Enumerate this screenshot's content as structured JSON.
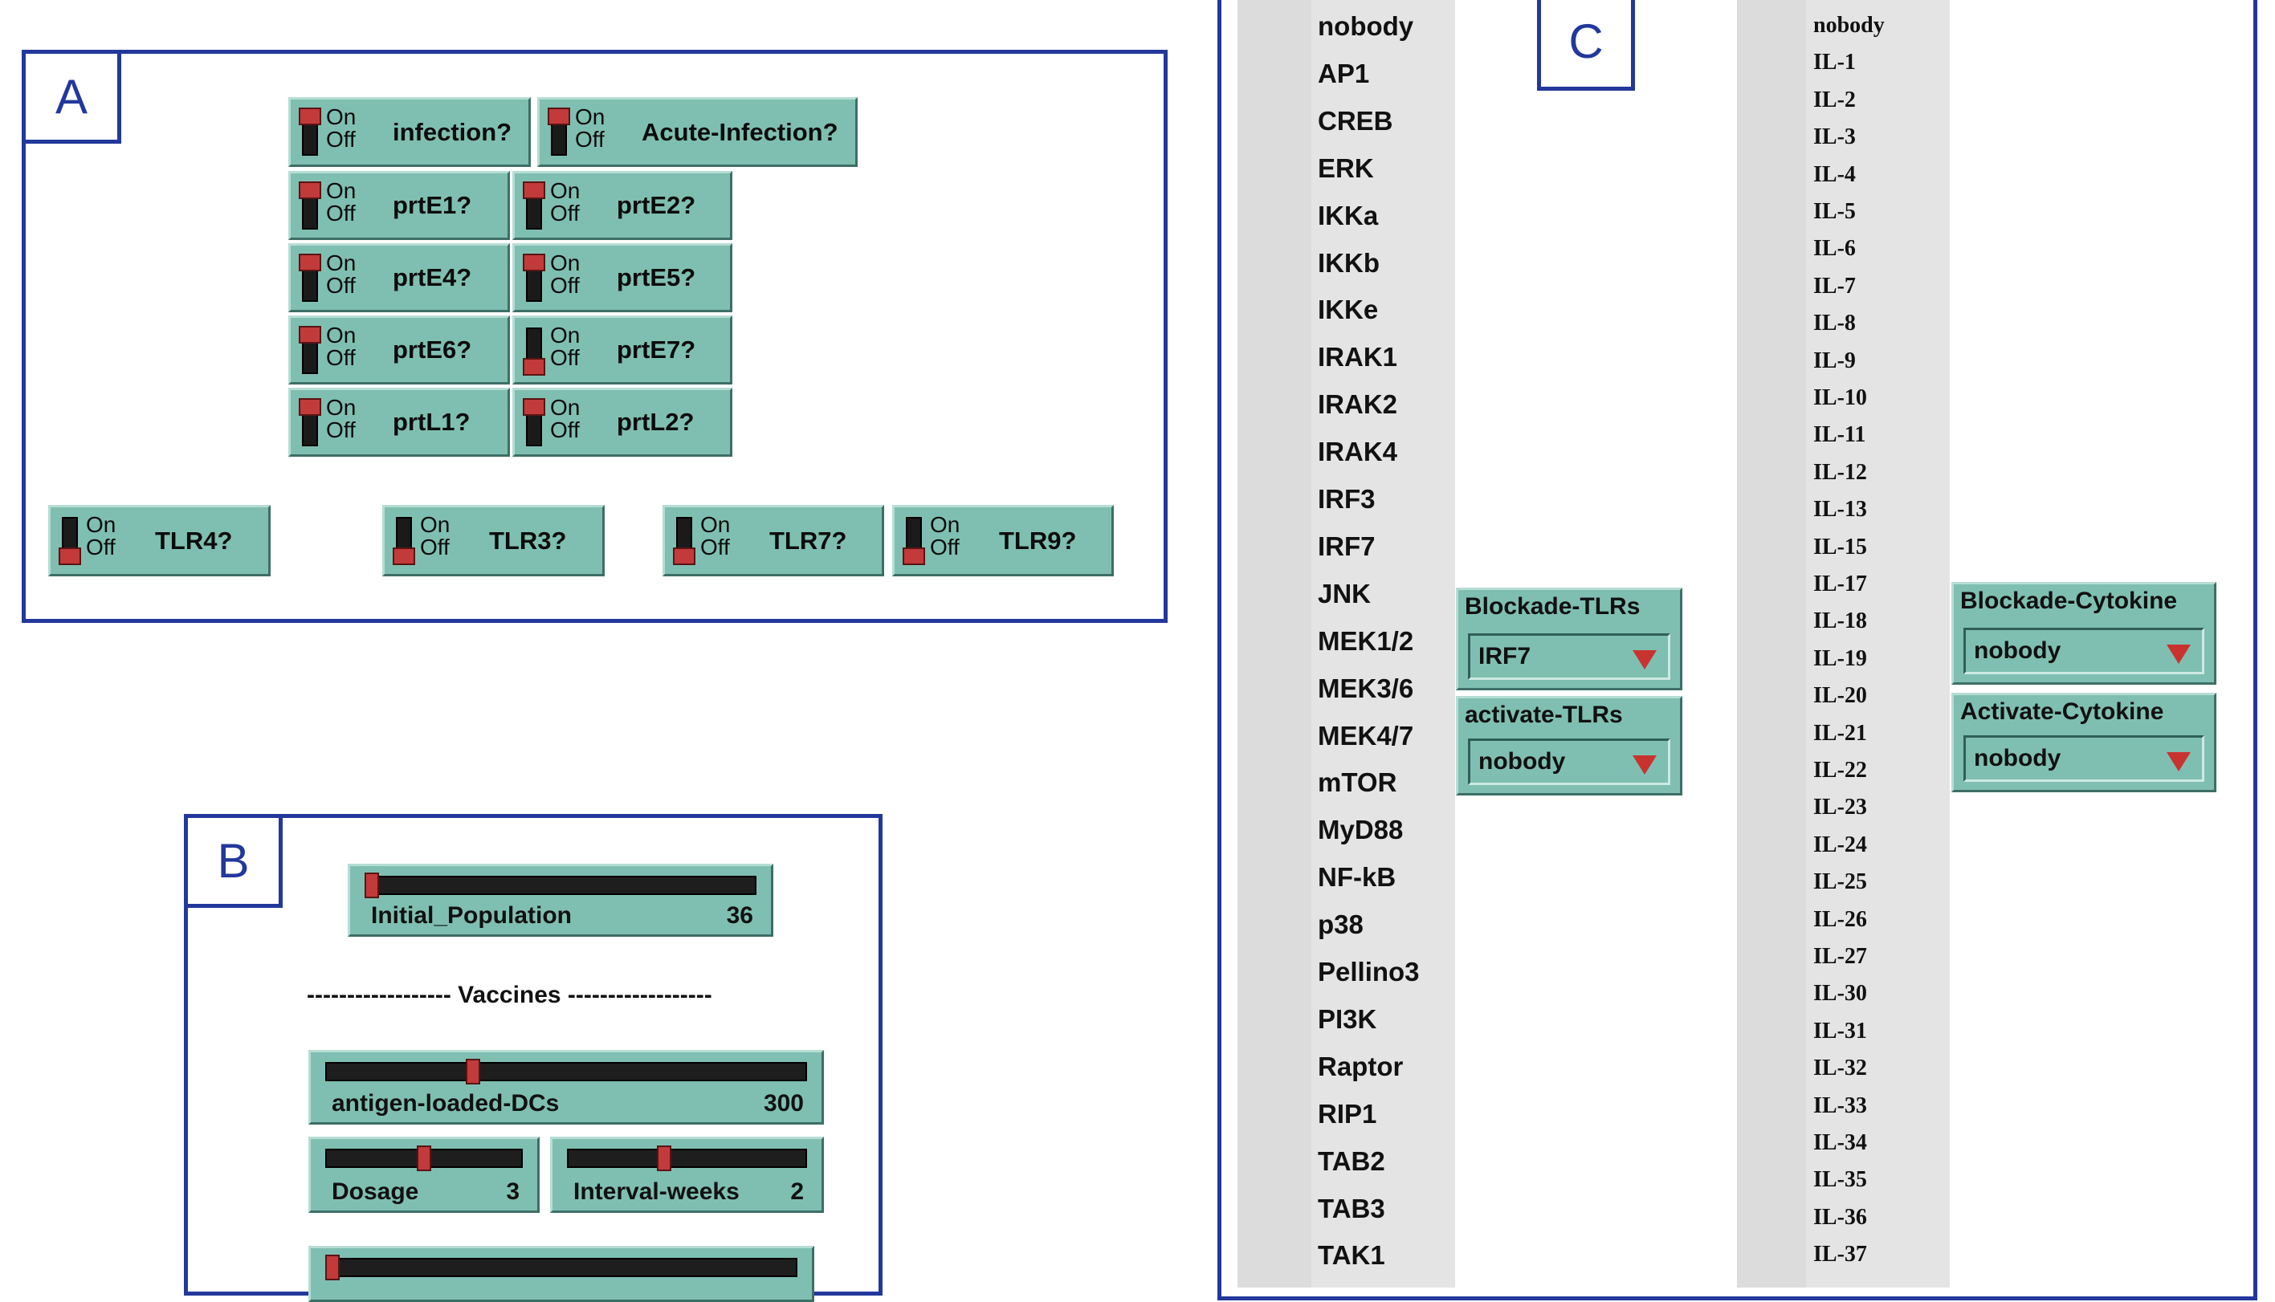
{
  "panels": {
    "a": "A",
    "b": "B",
    "c": "C"
  },
  "switch_on": "On",
  "switch_off": "Off",
  "switches": {
    "infection": {
      "label": "infection?",
      "on": true
    },
    "acute_infection": {
      "label": "Acute-Infection?",
      "on": true
    },
    "prtE1": {
      "label": "prtE1?",
      "on": true
    },
    "prtE2": {
      "label": "prtE2?",
      "on": true
    },
    "prtE4": {
      "label": "prtE4?",
      "on": true
    },
    "prtE5": {
      "label": "prtE5?",
      "on": true
    },
    "prtE6": {
      "label": "prtE6?",
      "on": true
    },
    "prtE7": {
      "label": "prtE7?",
      "on": false
    },
    "prtL1": {
      "label": "prtL1?",
      "on": true
    },
    "prtL2": {
      "label": "prtL2?",
      "on": true
    },
    "tlr4": {
      "label": "TLR4?",
      "on": false
    },
    "tlr3": {
      "label": "TLR3?",
      "on": false
    },
    "tlr7": {
      "label": "TLR7?",
      "on": false
    },
    "tlr9": {
      "label": "TLR9?",
      "on": false
    }
  },
  "sliders": {
    "initial_population": {
      "name": "Initial_Population",
      "value": "36",
      "fraction": 0.0
    },
    "antigen_loaded_dcs": {
      "name": "antigen-loaded-DCs",
      "value": "300",
      "fraction": 0.3
    },
    "dosage": {
      "name": "Dosage",
      "value": "3",
      "fraction": 0.5
    },
    "interval_weeks": {
      "name": "Interval-weeks",
      "value": "2",
      "fraction": 0.4
    },
    "bottom_slider": {
      "name": "",
      "value": "",
      "fraction": 0.0
    }
  },
  "vaccines_separator": "------------------ Vaccines ------------------",
  "choosers": {
    "blockade_tlrs": {
      "label": "Blockade-TLRs",
      "value": "IRF7"
    },
    "activate_tlrs": {
      "label": "activate-TLRs",
      "value": "nobody"
    },
    "blockade_cytokine": {
      "label": "Blockade-Cytokine",
      "value": "nobody"
    },
    "activate_cytokine": {
      "label": "Activate-Cytokine",
      "value": "nobody"
    }
  },
  "tlr_options": [
    "nobody",
    "AP1",
    "CREB",
    "ERK",
    "IKKa",
    "IKKb",
    "IKKe",
    "IRAK1",
    "IRAK2",
    "IRAK4",
    "IRF3",
    "IRF7",
    "JNK",
    "MEK1/2",
    "MEK3/6",
    "MEK4/7",
    "mTOR",
    "MyD88",
    "NF-kB",
    "p38",
    "Pellino3",
    "PI3K",
    "Raptor",
    "RIP1",
    "TAB2",
    "TAB3",
    "TAK1"
  ],
  "cytokine_options": [
    "nobody",
    "IL-1",
    "IL-2",
    "IL-3",
    "IL-4",
    "IL-5",
    "IL-6",
    "IL-7",
    "IL-8",
    "IL-9",
    "IL-10",
    "IL-11",
    "IL-12",
    "IL-13",
    "IL-15",
    "IL-17",
    "IL-18",
    "IL-19",
    "IL-20",
    "IL-21",
    "IL-22",
    "IL-23",
    "IL-24",
    "IL-25",
    "IL-26",
    "IL-27",
    "IL-30",
    "IL-31",
    "IL-32",
    "IL-33",
    "IL-34",
    "IL-35",
    "IL-36",
    "IL-37"
  ]
}
